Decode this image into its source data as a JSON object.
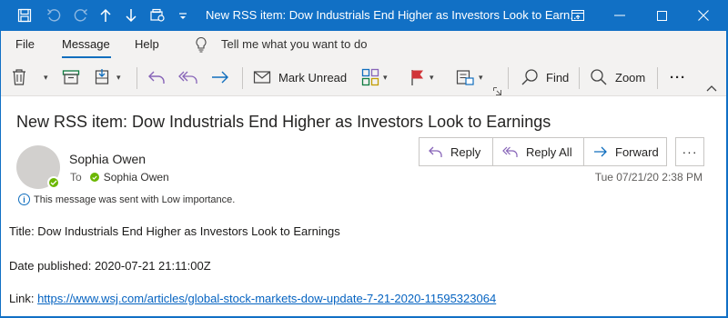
{
  "window": {
    "title": "New RSS item: Dow Industrials End Higher as Investors Look to Earn...",
    "quick_access": [
      "save-icon",
      "undo-icon",
      "redo-icon",
      "previous-item-icon",
      "next-item-icon",
      "customize-icon",
      "qat-dropdown-icon"
    ],
    "controls": [
      "restore-ribbon-icon",
      "minimize-icon",
      "maximize-icon",
      "close-icon"
    ],
    "accent": "#1170c5"
  },
  "tabs": {
    "file": "File",
    "message": "Message",
    "help": "Help",
    "tell_me": "Tell me what you want to do"
  },
  "ribbon": {
    "mark_unread": "Mark Unread",
    "find": "Find",
    "zoom": "Zoom",
    "more": "···"
  },
  "message": {
    "subject": "New RSS item: Dow Industrials End Higher as Investors Look to Earnings",
    "sender": "Sophia Owen",
    "to_label": "To",
    "to_name": "Sophia Owen",
    "reply": "Reply",
    "reply_all": "Reply All",
    "forward": "Forward",
    "more": "···",
    "date": "Tue 07/21/20 2:38 PM",
    "importance": "This message was sent with Low importance.",
    "info_glyph": "i",
    "body": {
      "title_line": "Title: Dow Industrials End Higher as Investors Look to Earnings",
      "date_line": "Date published: 2020-07-21 21:11:00Z",
      "link_label": "Link: ",
      "link_url": "https://www.wsj.com/articles/global-stock-markets-dow-update-7-21-2020-11595323064"
    }
  },
  "colors": {
    "link": "#0563c1",
    "presence": "#6bb700",
    "reply_icon": "#8764b8",
    "forward_icon": "#106ebe"
  }
}
